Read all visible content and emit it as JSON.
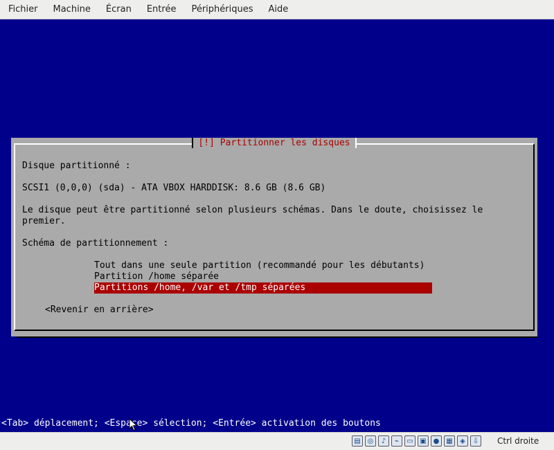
{
  "menubar": {
    "items": [
      "Fichier",
      "Machine",
      "Écran",
      "Entrée",
      "Périphériques",
      "Aide"
    ]
  },
  "dialog": {
    "title": "[!] Partitionner les disques",
    "disk_label": "Disque partitionné :",
    "disk_value": "SCSI1 (0,0,0) (sda) - ATA VBOX HARDDISK: 8.6 GB (8.6 GB)",
    "description_line1": "Le disque peut être partitionné selon plusieurs schémas. Dans le doute, choisissez le",
    "description_line2": "premier.",
    "scheme_label": "Schéma de partitionnement :",
    "options": [
      "Tout dans une seule partition (recommandé pour les débutants)",
      "Partition /home séparée",
      "Partitions /home, /var et /tmp séparées"
    ],
    "selected_option_index": 2,
    "back_button": "<Revenir en arrière>"
  },
  "help_line": "<Tab> déplacement; <Espace> sélection; <Entrée> activation des boutons",
  "statusbar": {
    "icons": [
      "hard-disk-icon",
      "optical-drive-icon",
      "audio-icon",
      "usb-icon",
      "shared-folders-icon",
      "display-icon",
      "video-capture-icon",
      "cpu-icon",
      "network-icon",
      "mouse-integration-icon"
    ],
    "host_key": "Ctrl droite"
  }
}
